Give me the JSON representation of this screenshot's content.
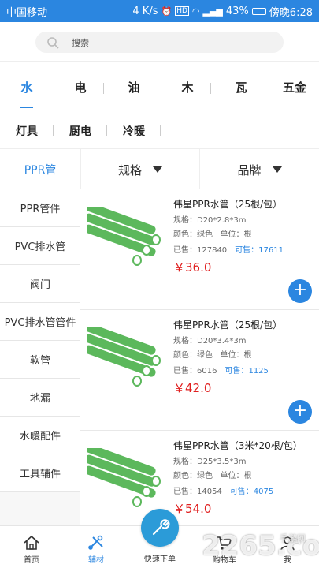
{
  "status": {
    "carrier": "中国移动",
    "speed": "4 K/s",
    "battery": "43%",
    "time": "傍晚6:28",
    "hd": "HD"
  },
  "search": {
    "placeholder": "搜索"
  },
  "categories": {
    "row1": [
      "水",
      "电",
      "油",
      "木",
      "瓦",
      "五金"
    ],
    "row2": [
      "灯具",
      "厨电",
      "冷暖"
    ],
    "active": "水"
  },
  "filters": {
    "selected": "PPR管",
    "spec": "规格",
    "brand": "品牌"
  },
  "sidebar": [
    "PPR管件",
    "PVC排水管",
    "阀门",
    "PVC排水管管件",
    "软管",
    "地漏",
    "水暖配件",
    "工具辅件"
  ],
  "products": [
    {
      "title": "伟星PPR水管（25根/包）",
      "spec": "规格：D20*2.8*3m",
      "color": "颜色：绿色",
      "unit": "单位：根",
      "sold": "已售：127840",
      "avail": "可售：17611",
      "price": "￥36.0"
    },
    {
      "title": "伟星PPR水管（25根/包）",
      "spec": "规格：D20*3.4*3m",
      "color": "颜色：绿色",
      "unit": "单位：根",
      "sold": "已售：6016",
      "avail": "可售：1125",
      "price": "￥42.0"
    },
    {
      "title": "伟星PPR水管（3米*20根/包）",
      "spec": "规格：D25*3.5*3m",
      "color": "颜色：绿色",
      "unit": "单位：根",
      "sold": "已售：14054",
      "avail": "可售：4075",
      "price": "￥54.0"
    }
  ],
  "tabbar": {
    "home": "首页",
    "materials": "辅材",
    "quick": "快速下单",
    "cart": "购物车",
    "me": "我"
  },
  "watermark": {
    "main": "2265.com",
    "sub": "手游网"
  },
  "colors": {
    "accent": "#2b86e0",
    "price": "#e02020",
    "pipe": "#5cb85c"
  }
}
